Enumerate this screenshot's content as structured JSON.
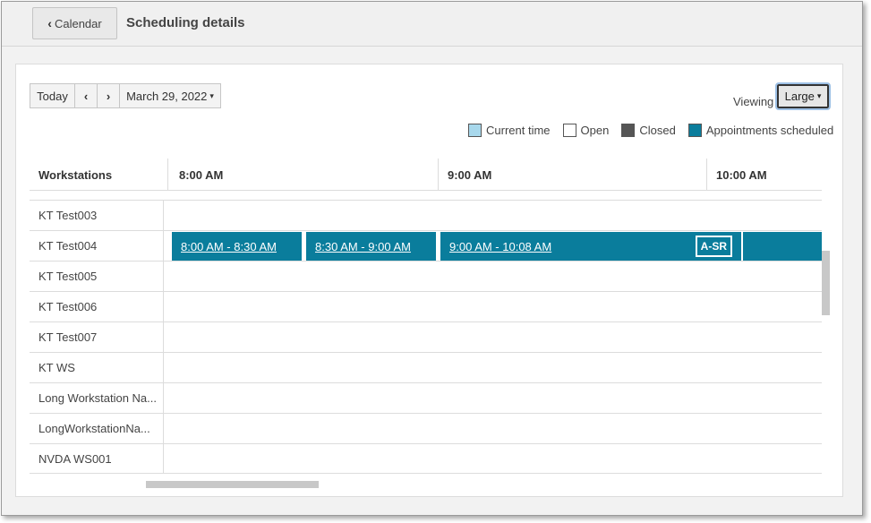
{
  "header": {
    "back_label": "Calendar",
    "title": "Scheduling details"
  },
  "toolbar": {
    "today_label": "Today",
    "prev_icon": "chevron-left-icon",
    "next_icon": "chevron-right-icon",
    "date_label": "March 29, 2022",
    "viewing_label": "Viewing",
    "viewing_value": "Large"
  },
  "legend": [
    {
      "label": "Current time",
      "color": "#a8d8ec"
    },
    {
      "label": "Open",
      "color": "#ffffff"
    },
    {
      "label": "Closed",
      "color": "#555555"
    },
    {
      "label": "Appointments scheduled",
      "color": "#0a7d9c"
    }
  ],
  "grid": {
    "workstations_header": "Workstations",
    "time_headers": [
      "8:00 AM",
      "9:00 AM",
      "10:00 AM"
    ],
    "rows": [
      {
        "name": "KT Test003"
      },
      {
        "name": "KT Test004"
      },
      {
        "name": "KT Test005"
      },
      {
        "name": "KT Test006"
      },
      {
        "name": "KT Test007"
      },
      {
        "name": "KT WS"
      },
      {
        "name": "Long Workstation Na..."
      },
      {
        "name": "LongWorkstationNa..."
      },
      {
        "name": "NVDA WS001"
      }
    ],
    "appointments": [
      {
        "label": "8:00 AM - 8:30 AM"
      },
      {
        "label": "8:30 AM - 9:00 AM"
      },
      {
        "label": "9:00 AM - 10:08 AM",
        "badge": "A-SR"
      }
    ]
  },
  "colors": {
    "appointment": "#0a7d9c",
    "current_time": "#a8d8ec",
    "closed": "#555555"
  }
}
